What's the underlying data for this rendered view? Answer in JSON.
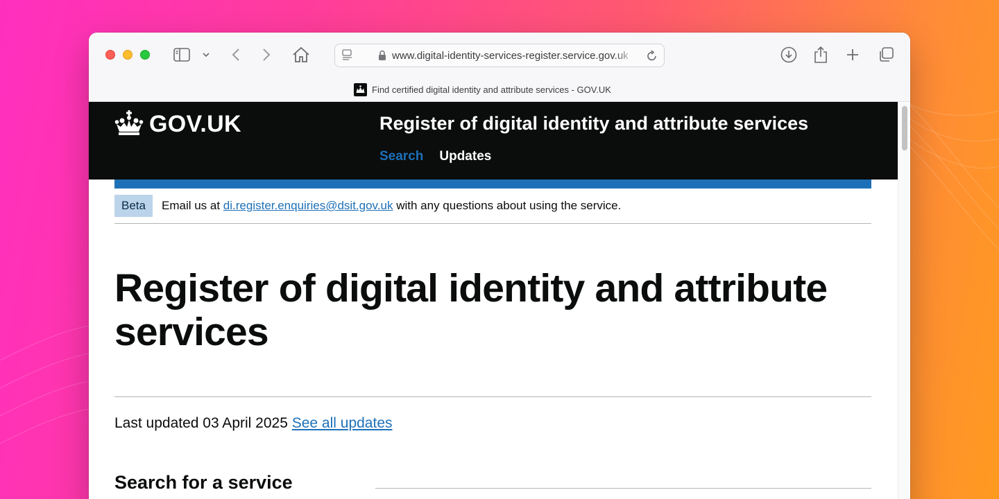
{
  "browser": {
    "url": "www.digital-identity-services-register.service.gov.uk",
    "tab_title": "Find certified digital identity and attribute services - GOV.UK"
  },
  "header": {
    "logo": "GOV.UK",
    "service_name": "Register of digital identity and attribute services",
    "nav": [
      {
        "label": "Search",
        "active": true
      },
      {
        "label": "Updates",
        "active": false
      }
    ]
  },
  "phase_banner": {
    "tag": "Beta",
    "text_before": "Email us at ",
    "email": "di.register.enquiries@dsit.gov.uk",
    "text_after": " with any questions about using the service."
  },
  "main": {
    "title": "Register of digital identity and attribute services",
    "last_updated_label": "Last updated 03 April 2025",
    "see_all_updates": "See all updates",
    "search_heading": "Search for a service"
  },
  "colors": {
    "header_bg": "#0b0c0c",
    "link_blue": "#1d70b8",
    "beta_tag_bg": "#bbd4ea"
  },
  "icons": [
    "sidebar-icon",
    "chevron-down-icon",
    "back-icon",
    "forward-icon",
    "home-icon",
    "reader-icon",
    "lock-icon",
    "reload-icon",
    "download-icon",
    "share-icon",
    "plus-icon",
    "tabs-icon",
    "crown-icon"
  ]
}
